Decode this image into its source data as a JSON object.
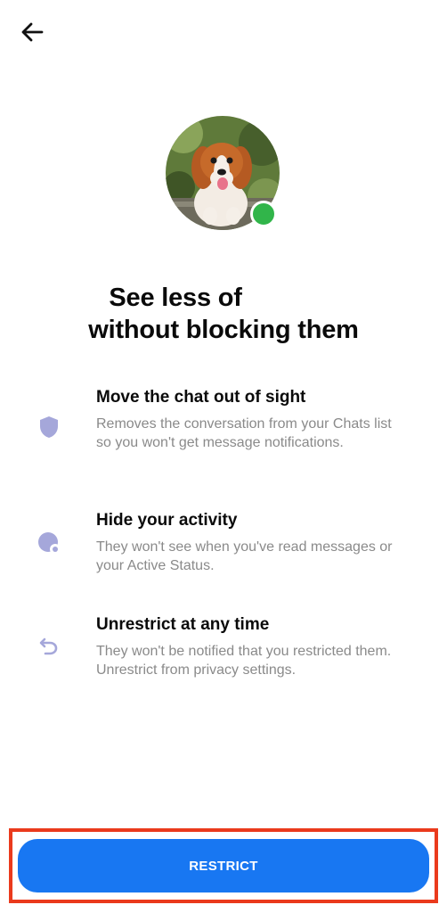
{
  "header": {
    "back_icon": "arrow-left-icon"
  },
  "profile": {
    "online_color": "#31b54a"
  },
  "headline": {
    "prefix": "See less of",
    "line2": "without blocking them"
  },
  "features": [
    {
      "icon": "shield-icon",
      "title": "Move the chat out of sight",
      "description": "Removes the conversation from your Chats list so you won't get message notifications."
    },
    {
      "icon": "hidden-activity-icon",
      "title": "Hide your activity",
      "description": "They won't see when you've read messages or your Active Status."
    },
    {
      "icon": "undo-icon",
      "title": "Unrestrict at any time",
      "description": "They won't be notified that you restricted them. Unrestrict from privacy settings."
    }
  ],
  "action": {
    "restrict_label": "RESTRICT",
    "button_color": "#1877f2",
    "highlight_color": "#ea3a1c"
  }
}
